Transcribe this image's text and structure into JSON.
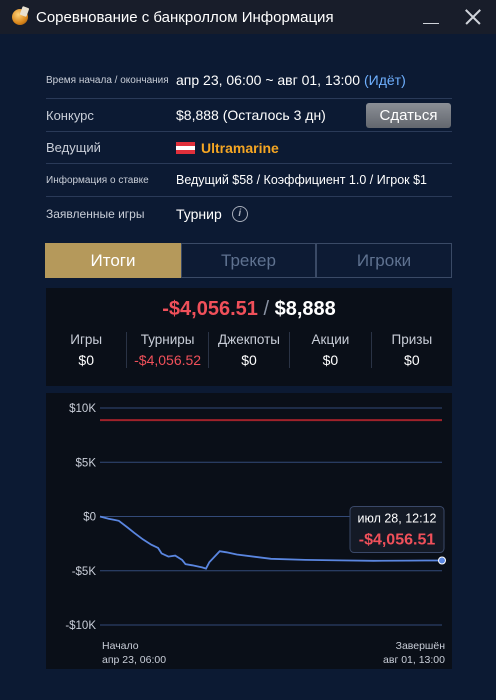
{
  "window": {
    "title": "Соревнование с банкроллом Информация",
    "app_icon": "poker-chip-app-icon"
  },
  "info": {
    "time_label": "Время начала / окончания",
    "time_value": "апр 23, 06:00 ~ авг 01, 13:00",
    "time_status": "(Идёт)",
    "contest_label": "Конкурс",
    "contest_value": "$8,888 (Осталось 3 дн)",
    "surrender_label": "Сдаться",
    "host_label": "Ведущий",
    "host_value": "Ultramarine",
    "bet_label": "Информация о ставке",
    "bet_value": "Ведущий $58 / Коэффициент 1.0 / Игрок $1",
    "games_label": "Заявленные игры",
    "games_value": "Турнир",
    "games_info_glyph": "i"
  },
  "tabs": [
    "Итоги",
    "Трекер",
    "Игроки"
  ],
  "summary": {
    "result": "-$4,056.51",
    "separator": "/",
    "target": "$8,888",
    "columns": [
      {
        "header": "Игры",
        "value": "$0",
        "negative": false
      },
      {
        "header": "Турниры",
        "value": "-$4,056.52",
        "negative": true
      },
      {
        "header": "Джекпоты",
        "value": "$0",
        "negative": false
      },
      {
        "header": "Акции",
        "value": "$0",
        "negative": false
      },
      {
        "header": "Призы",
        "value": "$0",
        "negative": false
      }
    ]
  },
  "chart_data": {
    "type": "line",
    "title": "",
    "xlabel": "",
    "ylabel": "",
    "y_ticks": [
      "$10K",
      "$5K",
      "$0",
      "-$5K",
      "-$10K"
    ],
    "ylim": [
      -10000,
      10000
    ],
    "x_start_label": "Начало",
    "x_start_date": "апр 23, 06:00",
    "x_end_label": "Завершён",
    "x_end_date": "авг 01, 13:00",
    "target_line": 8888,
    "series": [
      {
        "values": [
          [
            0,
            0
          ],
          [
            2.5,
            -200
          ],
          [
            4,
            -300
          ],
          [
            5.5,
            -400
          ],
          [
            8,
            -1000
          ],
          [
            10,
            -1500
          ],
          [
            12.5,
            -2100
          ],
          [
            15,
            -2600
          ],
          [
            17,
            -2900
          ],
          [
            18,
            -3400
          ],
          [
            20,
            -3700
          ],
          [
            22,
            -3600
          ],
          [
            24,
            -4000
          ],
          [
            25,
            -4400
          ],
          [
            27,
            -4500
          ],
          [
            30,
            -4700
          ],
          [
            31,
            -4800
          ],
          [
            32,
            -4200
          ],
          [
            35,
            -3200
          ],
          [
            37,
            -3300
          ],
          [
            40,
            -3500
          ],
          [
            50,
            -3900
          ],
          [
            60,
            -4000
          ],
          [
            70,
            -4050
          ],
          [
            80,
            -4080
          ],
          [
            90,
            -4060
          ],
          [
            95,
            -4057
          ],
          [
            100,
            -4056.51
          ]
        ]
      }
    ],
    "tooltip": {
      "date": "июл 28, 12:12",
      "value": "-$4,056.51"
    },
    "colors": {
      "line": "#5a86e0",
      "target_line": "#a0222a",
      "grid": "#334a78",
      "tooltip_value": "#f0505a"
    }
  }
}
